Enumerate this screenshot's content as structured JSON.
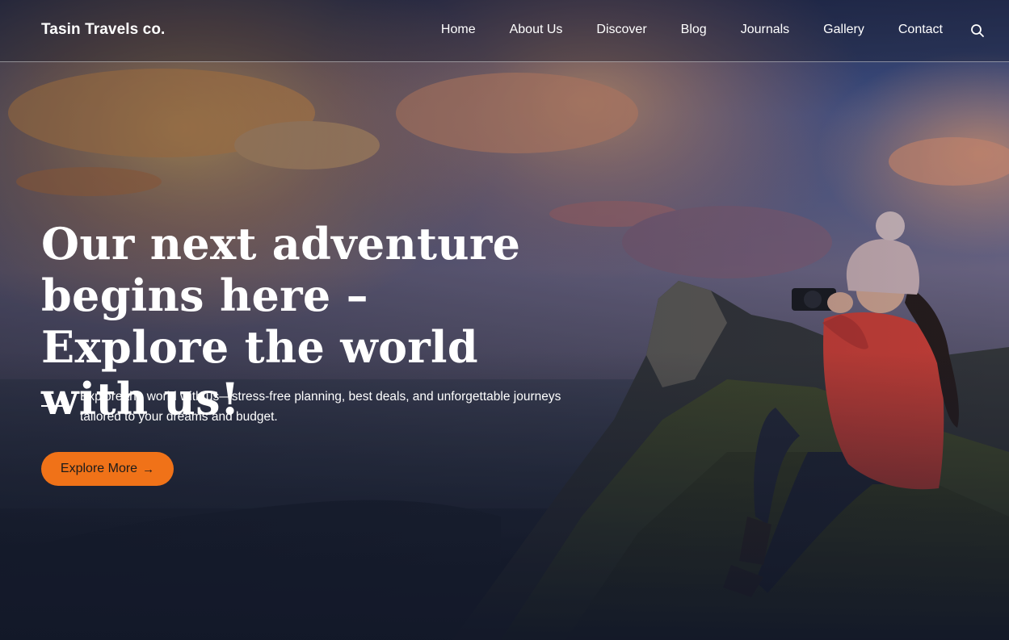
{
  "brand": "Tasin Travels co.",
  "nav": {
    "items": [
      {
        "label": "Home"
      },
      {
        "label": "About Us"
      },
      {
        "label": "Discover"
      },
      {
        "label": "Blog"
      },
      {
        "label": "Journals"
      },
      {
        "label": "Gallery"
      },
      {
        "label": "Contact"
      }
    ],
    "search_icon": "search-icon"
  },
  "hero": {
    "headline": "Our next adventure begins here – Explore the world with us!",
    "subtext": "Explore the world with us—stress-free planning, best deals, and unforgettable journeys tailored to your dreams and budget.",
    "cta_label": "Explore More",
    "cta_icon": "arrow-right-icon"
  },
  "colors": {
    "accent": "#f07218",
    "text": "#ffffff",
    "overlay": "#111827"
  }
}
